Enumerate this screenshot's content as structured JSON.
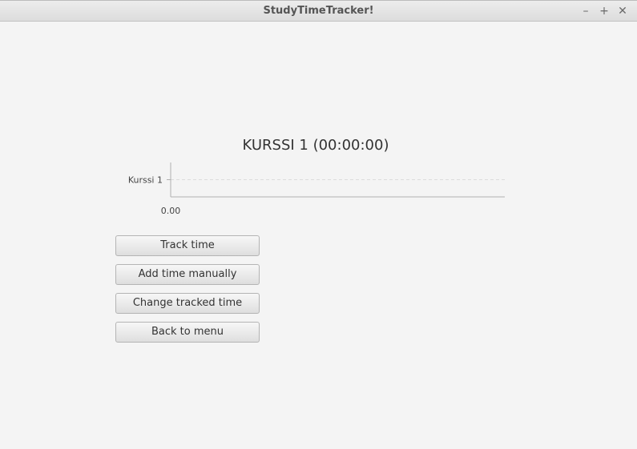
{
  "window": {
    "title": "StudyTimeTracker!",
    "controls": {
      "minimize": "–",
      "maximize": "+",
      "close": "✕"
    }
  },
  "chart_data": {
    "type": "bar",
    "title": "KURSSI 1 (00:00:00)",
    "orientation": "horizontal",
    "categories": [
      "Kurssi 1"
    ],
    "values": [
      0
    ],
    "x_tick_labels": [
      "0.00"
    ],
    "grid": true,
    "legend": "none"
  },
  "actions": {
    "track_time": "Track time",
    "add_time_manually": "Add time manually",
    "change_tracked_time": "Change tracked time",
    "back_to_menu": "Back to menu"
  }
}
